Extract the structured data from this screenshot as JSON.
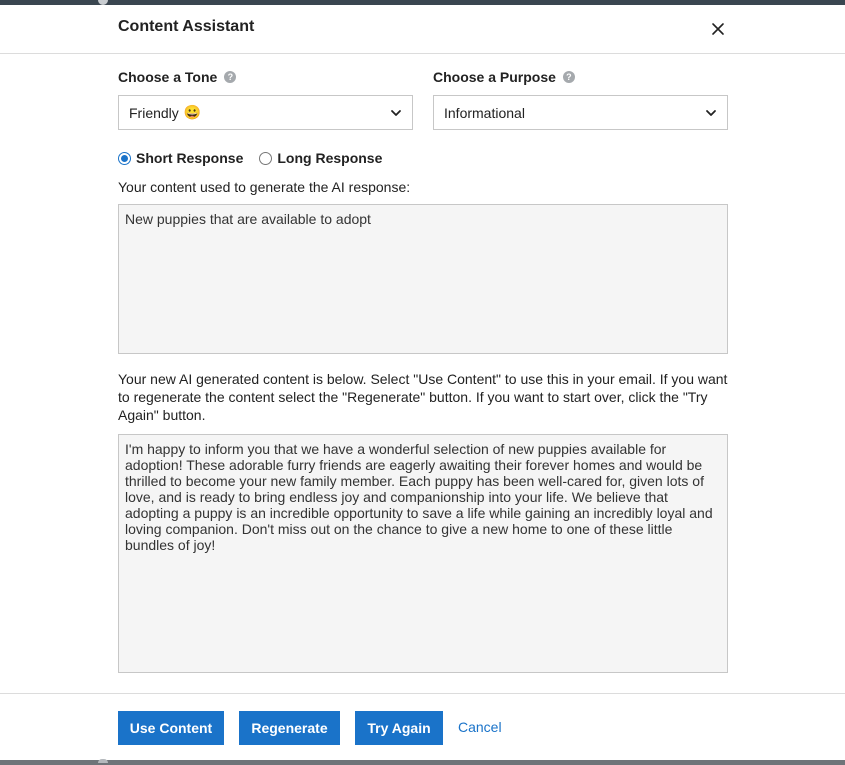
{
  "dialog": {
    "title": "Content Assistant",
    "close_icon": "close-icon"
  },
  "tone": {
    "label": "Choose a Tone",
    "help": "?",
    "value": "Friendly",
    "emoji": "😀"
  },
  "purpose": {
    "label": "Choose a Purpose",
    "help": "?",
    "value": "Informational"
  },
  "response_length": {
    "options": [
      {
        "label": "Short Response",
        "checked": true
      },
      {
        "label": "Long Response",
        "checked": false
      }
    ]
  },
  "input": {
    "label": "Your content used to generate the AI response:",
    "value": "New puppies that are available to adopt"
  },
  "output": {
    "instructions": "Your new AI generated content is below. Select \"Use Content\" to use this in your email. If you want to regenerate the content select the \"Regenerate\" button. If you want to start over, click the \"Try Again\" button.",
    "value": "I'm happy to inform you that we have a wonderful selection of new puppies available for adoption! These adorable furry friends are eagerly awaiting their forever homes and would be thrilled to become your new family member. Each puppy has been well-cared for, given lots of love, and is ready to bring endless joy and companionship into your life. We believe that adopting a puppy is an incredible opportunity to save a life while gaining an incredibly loyal and loving companion. Don't miss out on the chance to give a new home to one of these little bundles of joy!"
  },
  "footer": {
    "use_content": "Use Content",
    "regenerate": "Regenerate",
    "try_again": "Try Again",
    "cancel": "Cancel"
  },
  "colors": {
    "accent": "#1a73c9",
    "textarea_bg": "#f5f5f5"
  }
}
